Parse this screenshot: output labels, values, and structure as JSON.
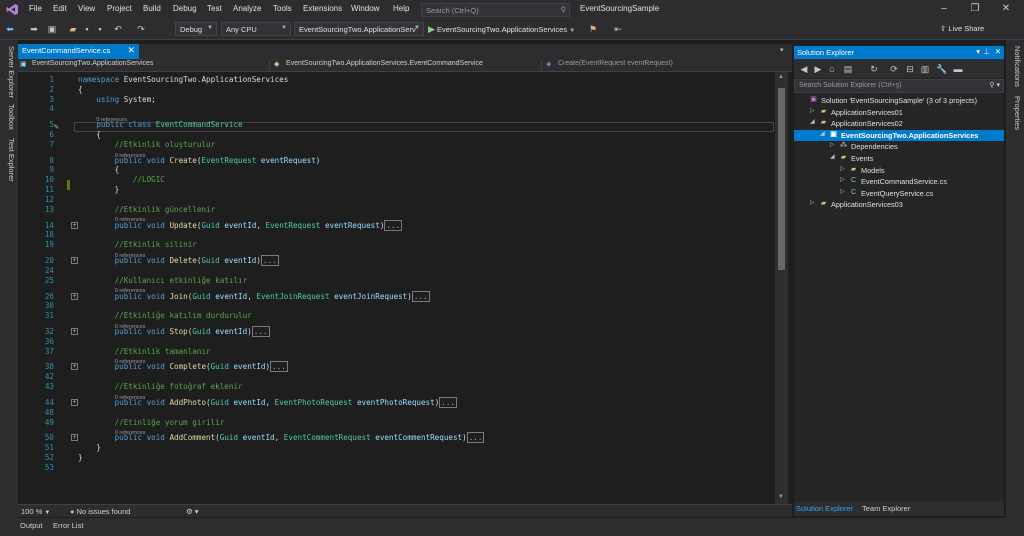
{
  "menu": {
    "items": [
      "File",
      "Edit",
      "View",
      "Project",
      "Build",
      "Debug",
      "Test",
      "Analyze",
      "Tools",
      "Extensions",
      "Window",
      "Help"
    ],
    "search_placeholder": "Search (Ctrl+Q)",
    "window_title": "EventSourcingSample"
  },
  "toolbar": {
    "config": "Debug",
    "platform": "Any CPU",
    "startup_project": "EventSourcingTwo.ApplicationServ",
    "run_label": "EventSourcingTwo.ApplicationServices",
    "live_share": "Live Share"
  },
  "left_rail": {
    "tabs": [
      "Server Explorer",
      "Toolbox",
      "Test Explorer"
    ]
  },
  "right_rail": {
    "tabs": [
      "Notifications",
      "Properties"
    ]
  },
  "editor": {
    "tab_label": "EventCommandService.cs",
    "nav": {
      "project": "EventSourcingTwo.ApplicationServices",
      "type": "EventSourcingTwo.ApplicationServices.EventCommandService",
      "member": "Create(EventRequest eventRequest)"
    },
    "lens_text": "0 references",
    "collapsed_text": "...",
    "lines": [
      {
        "n": "1",
        "code": [
          [
            "kw",
            "namespace"
          ],
          [
            "pl",
            " EventSourcingTwo.ApplicationServices"
          ]
        ]
      },
      {
        "n": "2",
        "code": [
          [
            "pl",
            "{"
          ]
        ]
      },
      {
        "n": "3",
        "code": [
          [
            "pl",
            "    "
          ],
          [
            "kw",
            "using"
          ],
          [
            "pl",
            " System;"
          ]
        ]
      },
      {
        "n": "4",
        "code": []
      },
      {
        "n": "5",
        "lens": true,
        "code": [
          [
            "pl",
            "    "
          ],
          [
            "kw",
            "public class"
          ],
          [
            "pl",
            " "
          ],
          [
            "ty",
            "EventCommandService"
          ]
        ]
      },
      {
        "n": "6",
        "code": [
          [
            "pl",
            "    {"
          ]
        ]
      },
      {
        "n": "7",
        "code": [
          [
            "pl",
            "        "
          ],
          [
            "cm",
            "//Etkinlik oluşturulur"
          ]
        ]
      },
      {
        "n": "8",
        "lens": true,
        "code": [
          [
            "pl",
            "        "
          ],
          [
            "kw",
            "public void"
          ],
          [
            "pl",
            " "
          ],
          [
            "fn",
            "Create"
          ],
          [
            "pl",
            "("
          ],
          [
            "ty",
            "EventRequest"
          ],
          [
            "pl",
            " "
          ],
          [
            "pr",
            "eventRequest"
          ],
          [
            "pl",
            ")"
          ]
        ]
      },
      {
        "n": "9",
        "code": [
          [
            "pl",
            "        {"
          ]
        ]
      },
      {
        "n": "10",
        "code": [
          [
            "pl",
            "            "
          ],
          [
            "cm",
            "//LOGIC"
          ]
        ]
      },
      {
        "n": "11",
        "code": [
          [
            "pl",
            "        }"
          ]
        ]
      },
      {
        "n": "12",
        "code": []
      },
      {
        "n": "13",
        "code": [
          [
            "pl",
            "        "
          ],
          [
            "cm",
            "//Etkinlik güncellenir"
          ]
        ]
      },
      {
        "n": "14",
        "lens": true,
        "fold": true,
        "code": [
          [
            "pl",
            "        "
          ],
          [
            "kw",
            "public void"
          ],
          [
            "pl",
            " "
          ],
          [
            "fn",
            "Update"
          ],
          [
            "pl",
            "("
          ],
          [
            "ty",
            "Guid"
          ],
          [
            "pl",
            " "
          ],
          [
            "pr",
            "eventId"
          ],
          [
            "pl",
            ", "
          ],
          [
            "ty",
            "EventRequest"
          ],
          [
            "pl",
            " "
          ],
          [
            "pr",
            "eventRequest"
          ],
          [
            "pl",
            ")"
          ],
          [
            "co",
            "..."
          ]
        ]
      },
      {
        "n": "18",
        "code": []
      },
      {
        "n": "19",
        "code": [
          [
            "pl",
            "        "
          ],
          [
            "cm",
            "//Etkinlik silinir"
          ]
        ]
      },
      {
        "n": "20",
        "lens": true,
        "fold": true,
        "code": [
          [
            "pl",
            "        "
          ],
          [
            "kw",
            "public void"
          ],
          [
            "pl",
            " "
          ],
          [
            "fn",
            "Delete"
          ],
          [
            "pl",
            "("
          ],
          [
            "ty",
            "Guid"
          ],
          [
            "pl",
            " "
          ],
          [
            "pr",
            "eventId"
          ],
          [
            "pl",
            ")"
          ],
          [
            "co",
            "..."
          ]
        ]
      },
      {
        "n": "24",
        "code": []
      },
      {
        "n": "25",
        "code": [
          [
            "pl",
            "        "
          ],
          [
            "cm",
            "//Kullanıcı etkinliğe katılır"
          ]
        ]
      },
      {
        "n": "26",
        "lens": true,
        "fold": true,
        "code": [
          [
            "pl",
            "        "
          ],
          [
            "kw",
            "public void"
          ],
          [
            "pl",
            " "
          ],
          [
            "fn",
            "Join"
          ],
          [
            "pl",
            "("
          ],
          [
            "ty",
            "Guid"
          ],
          [
            "pl",
            " "
          ],
          [
            "pr",
            "eventId"
          ],
          [
            "pl",
            ", "
          ],
          [
            "ty",
            "EventJoinRequest"
          ],
          [
            "pl",
            " "
          ],
          [
            "pr",
            "eventJoinRequest"
          ],
          [
            "pl",
            ")"
          ],
          [
            "co",
            "..."
          ]
        ]
      },
      {
        "n": "30",
        "code": []
      },
      {
        "n": "31",
        "code": [
          [
            "pl",
            "        "
          ],
          [
            "cm",
            "//Etkinliğe katılım durdurulur"
          ]
        ]
      },
      {
        "n": "32",
        "lens": true,
        "fold": true,
        "code": [
          [
            "pl",
            "        "
          ],
          [
            "kw",
            "public void"
          ],
          [
            "pl",
            " "
          ],
          [
            "fn",
            "Stop"
          ],
          [
            "pl",
            "("
          ],
          [
            "ty",
            "Guid"
          ],
          [
            "pl",
            " "
          ],
          [
            "pr",
            "eventId"
          ],
          [
            "pl",
            ")"
          ],
          [
            "co",
            "..."
          ]
        ]
      },
      {
        "n": "36",
        "code": []
      },
      {
        "n": "37",
        "code": [
          [
            "pl",
            "        "
          ],
          [
            "cm",
            "//Etkinlik tamanlanır"
          ]
        ]
      },
      {
        "n": "38",
        "lens": true,
        "fold": true,
        "code": [
          [
            "pl",
            "        "
          ],
          [
            "kw",
            "public void"
          ],
          [
            "pl",
            " "
          ],
          [
            "fn",
            "Complete"
          ],
          [
            "pl",
            "("
          ],
          [
            "ty",
            "Guid"
          ],
          [
            "pl",
            " "
          ],
          [
            "pr",
            "eventId"
          ],
          [
            "pl",
            ")"
          ],
          [
            "co",
            "..."
          ]
        ]
      },
      {
        "n": "42",
        "code": []
      },
      {
        "n": "43",
        "code": [
          [
            "pl",
            "        "
          ],
          [
            "cm",
            "//Etkinliğe fotoğraf eklenir"
          ]
        ]
      },
      {
        "n": "44",
        "lens": true,
        "fold": true,
        "code": [
          [
            "pl",
            "        "
          ],
          [
            "kw",
            "public void"
          ],
          [
            "pl",
            " "
          ],
          [
            "fn",
            "AddPhoto"
          ],
          [
            "pl",
            "("
          ],
          [
            "ty",
            "Guid"
          ],
          [
            "pl",
            " "
          ],
          [
            "pr",
            "eventId"
          ],
          [
            "pl",
            ", "
          ],
          [
            "ty",
            "EventPhotoRequest"
          ],
          [
            "pl",
            " "
          ],
          [
            "pr",
            "eventPhotoRequest"
          ],
          [
            "pl",
            ")"
          ],
          [
            "co",
            "..."
          ]
        ]
      },
      {
        "n": "48",
        "code": []
      },
      {
        "n": "49",
        "code": [
          [
            "pl",
            "        "
          ],
          [
            "cm",
            "//Etinliğe yorum girilir"
          ]
        ]
      },
      {
        "n": "50",
        "lens": true,
        "fold": true,
        "code": [
          [
            "pl",
            "        "
          ],
          [
            "kw",
            "public void"
          ],
          [
            "pl",
            " "
          ],
          [
            "fn",
            "AddComment"
          ],
          [
            "pl",
            "("
          ],
          [
            "ty",
            "Guid"
          ],
          [
            "pl",
            " "
          ],
          [
            "pr",
            "eventId"
          ],
          [
            "pl",
            ", "
          ],
          [
            "ty",
            "EventCommentRequest"
          ],
          [
            "pl",
            " "
          ],
          [
            "pr",
            "eventCommentRequest"
          ],
          [
            "pl",
            ")"
          ],
          [
            "co",
            "..."
          ]
        ]
      },
      {
        "n": "51",
        "code": [
          [
            "pl",
            "    }"
          ]
        ]
      },
      {
        "n": "52",
        "code": [
          [
            "pl",
            "}"
          ]
        ]
      },
      {
        "n": "53",
        "code": []
      }
    ]
  },
  "status": {
    "zoom": "100 %",
    "issues": "No issues found"
  },
  "bottom_tabs": [
    "Output",
    "Error List"
  ],
  "solution_explorer": {
    "title": "Solution Explorer",
    "search_placeholder": "Search Solution Explorer (Ctrl+ş)",
    "tree": [
      {
        "label": "Solution 'EventSourcingSample' (3 of 3 projects)",
        "indent": 0,
        "icon": "solution-icon",
        "exp": ""
      },
      {
        "label": "ApplicationServices01",
        "indent": 1,
        "icon": "folder-icon",
        "exp": "▷"
      },
      {
        "label": "ApplicationServices02",
        "indent": 1,
        "icon": "folder-icon",
        "exp": "◢"
      },
      {
        "label": "EventSourcingTwo.ApplicationServices",
        "indent": 2,
        "icon": "csproj-icon",
        "exp": "◢",
        "selected": true
      },
      {
        "label": "Dependencies",
        "indent": 3,
        "icon": "dependencies-icon",
        "exp": "▷"
      },
      {
        "label": "Events",
        "indent": 3,
        "icon": "folder-icon",
        "exp": "◢"
      },
      {
        "label": "Models",
        "indent": 4,
        "icon": "folder-icon",
        "exp": "▷"
      },
      {
        "label": "EventCommandService.cs",
        "indent": 4,
        "icon": "csharp-file-icon",
        "exp": "▷"
      },
      {
        "label": "EventQueryService.cs",
        "indent": 4,
        "icon": "csharp-file-icon",
        "exp": "▷"
      },
      {
        "label": "ApplicationServices03",
        "indent": 1,
        "icon": "folder-icon",
        "exp": "▷"
      }
    ],
    "bottom_tabs": [
      "Solution Explorer",
      "Team Explorer"
    ]
  },
  "colors": {
    "accent": "#007acc",
    "keyword": "#569cd6",
    "type": "#4ec9b0",
    "comment": "#57a64a",
    "method": "#dcdcaa",
    "param": "#9cdcfe",
    "folder": "#dcb67a"
  }
}
